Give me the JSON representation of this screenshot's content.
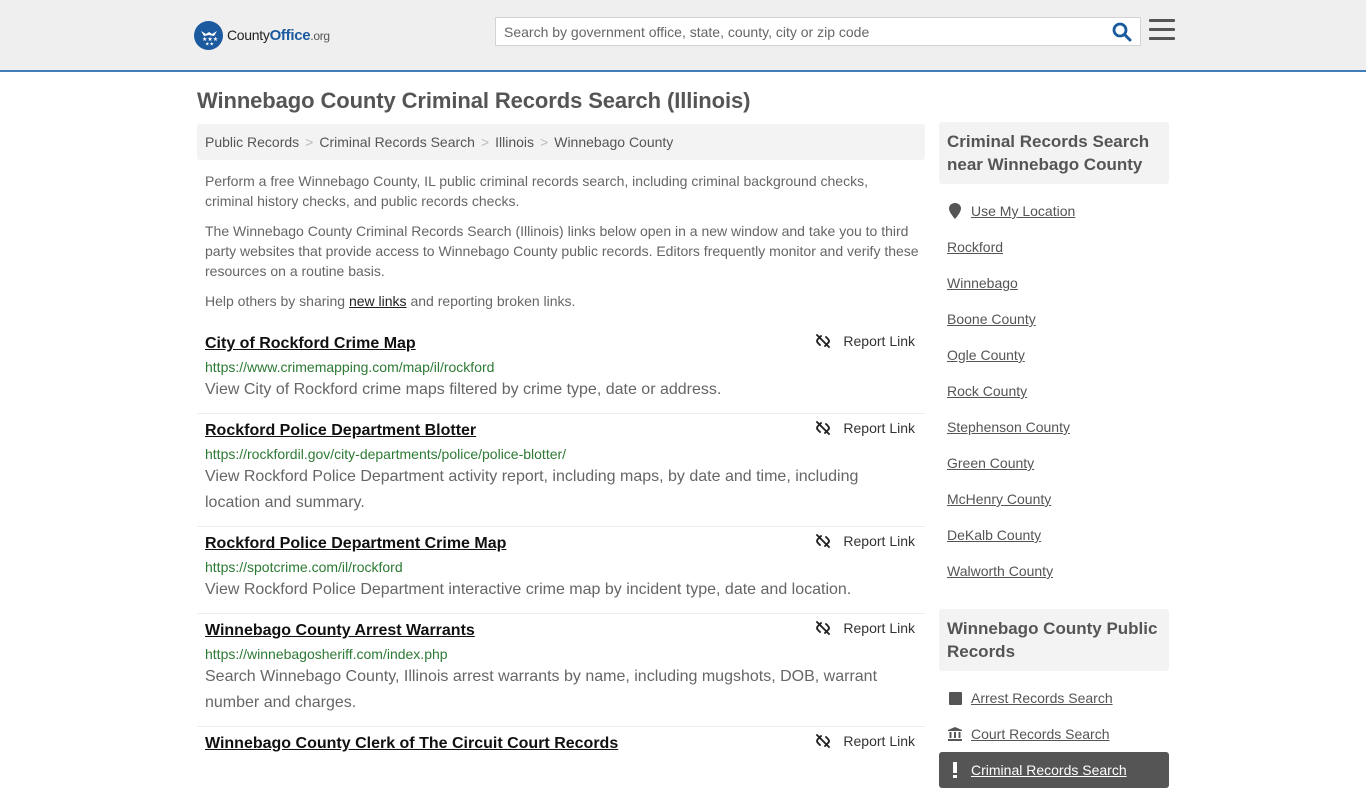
{
  "header": {
    "logo": {
      "name": "County",
      "brand": "Office",
      "tld": ".org"
    },
    "search": {
      "placeholder": "Search by government office, state, county, city or zip code",
      "value": ""
    },
    "icons": {
      "search": "search-icon",
      "menu": "hamburger-menu-icon",
      "logo": "eagle-stars-icon"
    }
  },
  "page": {
    "title": "Winnebago County Criminal Records Search (Illinois)",
    "breadcrumb": [
      "Public Records",
      "Criminal Records Search",
      "Illinois",
      "Winnebago County"
    ],
    "breadcrumb_separator": ">",
    "intro": {
      "p1": "Perform a free Winnebago County, IL public criminal records search, including criminal background checks, criminal history checks, and public records checks.",
      "p2": "The Winnebago County Criminal Records Search (Illinois) links below open in a new window and take you to third party websites that provide access to Winnebago County public records. Editors frequently monitor and verify these resources on a routine basis.",
      "p3_before": "Help others by sharing ",
      "p3_link": "new links",
      "p3_after": " and reporting broken links."
    }
  },
  "results": [
    {
      "title": "City of Rockford Crime Map",
      "url": "https://www.crimemapping.com/map/il/rockford",
      "description": "View City of Rockford crime maps filtered by crime type, date or address.",
      "report_label": "Report Link"
    },
    {
      "title": "Rockford Police Department Blotter",
      "url": "https://rockfordil.gov/city-departments/police/police-blotter/",
      "description": "View Rockford Police Department activity report, including maps, by date and time, including location and summary.",
      "report_label": "Report Link"
    },
    {
      "title": "Rockford Police Department Crime Map",
      "url": "https://spotcrime.com/il/rockford",
      "description": "View Rockford Police Department interactive crime map by incident type, date and location.",
      "report_label": "Report Link"
    },
    {
      "title": "Winnebago County Arrest Warrants",
      "url": "https://winnebagosheriff.com/index.php",
      "description": "Search Winnebago County, Illinois arrest warrants by name, including mugshots, DOB, warrant number and charges.",
      "report_label": "Report Link"
    },
    {
      "title": "Winnebago County Clerk of The Circuit Court Records",
      "url": "",
      "description": "",
      "report_label": "Report Link"
    }
  ],
  "sidebar": {
    "nearby": {
      "heading": "Criminal Records Search near Winnebago County",
      "use_location": "Use My Location",
      "items": [
        "Rockford",
        "Winnebago",
        "Boone County",
        "Ogle County",
        "Rock County",
        "Stephenson County",
        "Green County",
        "McHenry County",
        "DeKalb County",
        "Walworth County"
      ]
    },
    "public_records": {
      "heading": "Winnebago County Public Records",
      "items": [
        {
          "label": "Arrest Records Search",
          "icon": "square-icon",
          "active": false
        },
        {
          "label": "Court Records Search",
          "icon": "courthouse-icon",
          "active": false
        },
        {
          "label": "Criminal Records Search",
          "icon": "exclamation-icon",
          "active": true
        }
      ]
    }
  },
  "colors": {
    "brand_blue": "#1b5a9f",
    "topbar_border": "#3f7fb8",
    "url_green": "#2d7a34",
    "active_bg": "#555555"
  }
}
